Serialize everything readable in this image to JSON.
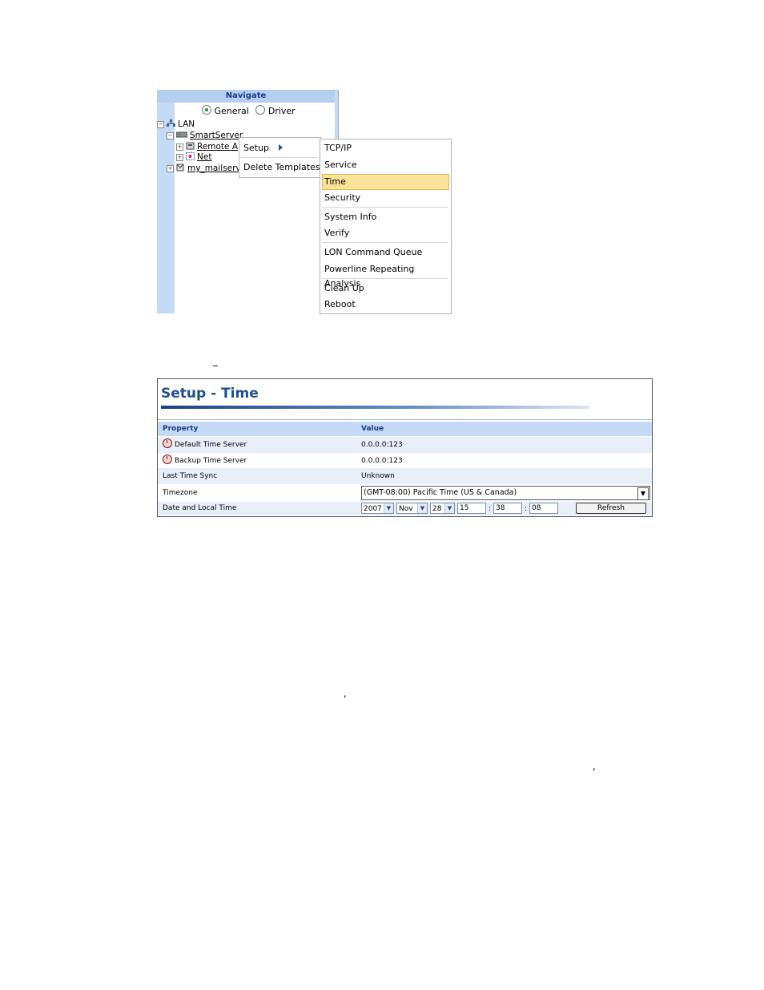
{
  "navigate": {
    "title": "Navigate",
    "radio_general": "General",
    "radio_driver": "Driver",
    "tree": {
      "lan": "LAN",
      "smartserver": "SmartServer",
      "remote": "Remote A",
      "net": "Net",
      "mailserver": "my_mailserv"
    }
  },
  "menu1": {
    "setup": "Setup",
    "delete_templates": "Delete Templates"
  },
  "menu2": {
    "items": [
      "TCP/IP",
      "Service",
      "Time",
      "Security",
      "System Info",
      "Verify",
      "LON Command Queue",
      "Powerline Repeating Analysis",
      "Clean Up",
      "Reboot"
    ],
    "selected": "Time"
  },
  "setup_time": {
    "title": "Setup - Time",
    "header_property": "Property",
    "header_value": "Value",
    "rows": [
      {
        "property": "Default Time Server",
        "value": "0.0.0.0:123"
      },
      {
        "property": "Backup Time Server",
        "value": "0.0.0.0:123"
      },
      {
        "property": "Last Time Sync",
        "value": "Unknown"
      },
      {
        "property": "Timezone",
        "value": "(GMT-08:00) Pacific Time (US & Canada)"
      },
      {
        "property": "Date and Local Time",
        "value": ""
      }
    ],
    "datetime": {
      "year": "2007",
      "month": "Nov",
      "day": "28",
      "hour": "15",
      "minute": "38",
      "second": "08",
      "separator": ":",
      "refresh_label": "Refresh"
    }
  },
  "stray_marks": {
    "underscore": "_",
    "comma": ","
  }
}
